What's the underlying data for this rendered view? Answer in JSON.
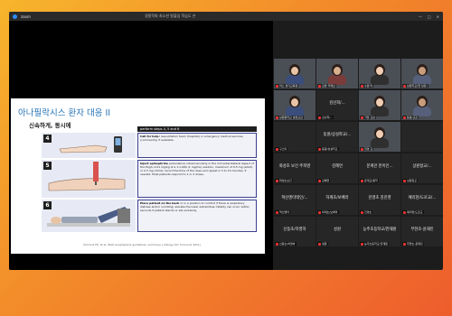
{
  "titlebar": {
    "app_name": "zoom",
    "title": "경찰학회 최소한 탈출업 학습도 온",
    "window_buttons": [
      "—",
      "□",
      "✕"
    ]
  },
  "slide": {
    "title": "아나필락시스 환자 대응 II",
    "subtitle": "신속하게, 동시에",
    "header": "perform steps 4, 5 and 6",
    "steps": [
      {
        "num": "4",
        "text_bold": "Call for help:",
        "text": "resuscitation team (hospital) or emergency medical services (community) if available."
      },
      {
        "num": "5",
        "text_bold": "Inject epinephrine",
        "text": "(adrenaline) intramuscularly in the mid-anterolateral aspect of the thigh, 0.01 mg/kg of a 1:1,000 (1 mg/mL) solution, maximum of 0.5 mg (adult) or 0.3 mg (child); record the time of the dose and repeat in 5 to 15 minutes, if needed. Most patients respond to 1 or 2 doses."
      },
      {
        "num": "6",
        "text_bold": "Place patient on the back",
        "text": "or in a position of comfort if there is respiratory distress and/or vomiting; elevate the lower extremities; fatality can occur within seconds if patient stands or sits suddenly."
      }
    ],
    "citation": "(Simons FE, et al. WAO anaphylaxis guidelines: summary. J Allergy Clin Immunol 2011)"
  },
  "gallery": [
    {
      "name": "",
      "label": "마스 경기교육청",
      "video": true
    },
    {
      "name": "",
      "label": "김영 국제감",
      "video": true
    },
    {
      "name": "",
      "label": "수원 미",
      "video": true
    },
    {
      "name": "",
      "label": "상원학교(현 실장)",
      "video": true
    },
    {
      "name": "",
      "label": "상원원학교 설정교감",
      "video": true
    },
    {
      "name": "김선희/...",
      "label": "김선희/...",
      "video": false
    },
    {
      "name": "",
      "label": "가장 교감",
      "video": true
    },
    {
      "name": "",
      "label": "동광/교감",
      "video": true
    },
    {
      "name": "",
      "label": "구스미",
      "video": false
    },
    {
      "name": "동원/상설학교/...",
      "label": "동원/상설학교",
      "video": false
    },
    {
      "name": "",
      "label": "한영 교",
      "video": true
    },
    {
      "name": "",
      "label": "",
      "video": false
    },
    {
      "name": "화성초 보건 주희영",
      "label": "화성초보건",
      "video": false
    },
    {
      "name": "김혜연",
      "label": "김혜연",
      "video": false
    },
    {
      "name": "문계관 한이인...",
      "label": "문계교/종학",
      "video": false
    },
    {
      "name": "상원정교/...",
      "label": "상원정교",
      "video": false
    },
    {
      "name": "혁신엔터테인/...",
      "label": "혁신엔터",
      "video": false
    },
    {
      "name": "하계초/보배라",
      "label": "하계초/보배라",
      "video": false
    },
    {
      "name": "진영초 김진영",
      "label": "진영초",
      "video": false
    },
    {
      "name": "예리현/도로교/...",
      "label": "예리현/도로교",
      "video": false
    },
    {
      "name": "신동초/하영하",
      "label": "신동초/하영하",
      "video": false
    },
    {
      "name": "성원",
      "label": "성원",
      "video": false
    },
    {
      "name": "능주초등학교/한재원",
      "label": "능주초등학교/한재원",
      "video": false
    },
    {
      "name": "무현초-윤재민",
      "label": "무현초-윤재민",
      "video": false
    }
  ]
}
